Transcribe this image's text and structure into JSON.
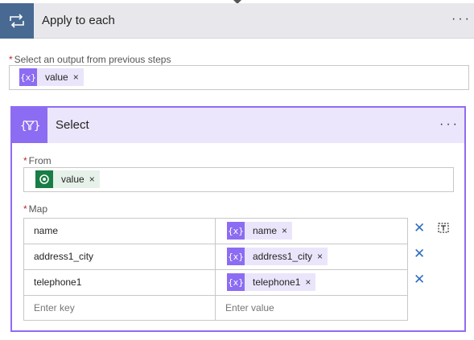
{
  "apply_to_each": {
    "title": "Apply to each",
    "more": "···",
    "output_label": "Select an output from previous steps",
    "token": {
      "label": "value",
      "icon": "{x}",
      "close": "×"
    }
  },
  "select": {
    "title": "Select",
    "more": "···",
    "from_label": "From",
    "from_token": {
      "label": "value",
      "close": "×"
    },
    "map_label": "Map",
    "rows": [
      {
        "key": "name",
        "value": "name",
        "icon": "{x}",
        "close": "×"
      },
      {
        "key": "address1_city",
        "value": "address1_city",
        "icon": "{x}",
        "close": "×"
      },
      {
        "key": "telephone1",
        "value": "telephone1",
        "icon": "{x}",
        "close": "×"
      }
    ],
    "key_placeholder": "Enter key",
    "value_placeholder": "Enter value"
  },
  "required_marker": "*",
  "delete_glyph": "✕",
  "colors": {
    "foreach_icon_bg": "#486991",
    "select_accent": "#8c6cf2",
    "token_purple_bg": "#ebe5fb",
    "dataverse_green": "#1a7d45",
    "delete_blue": "#2f6fbf"
  }
}
